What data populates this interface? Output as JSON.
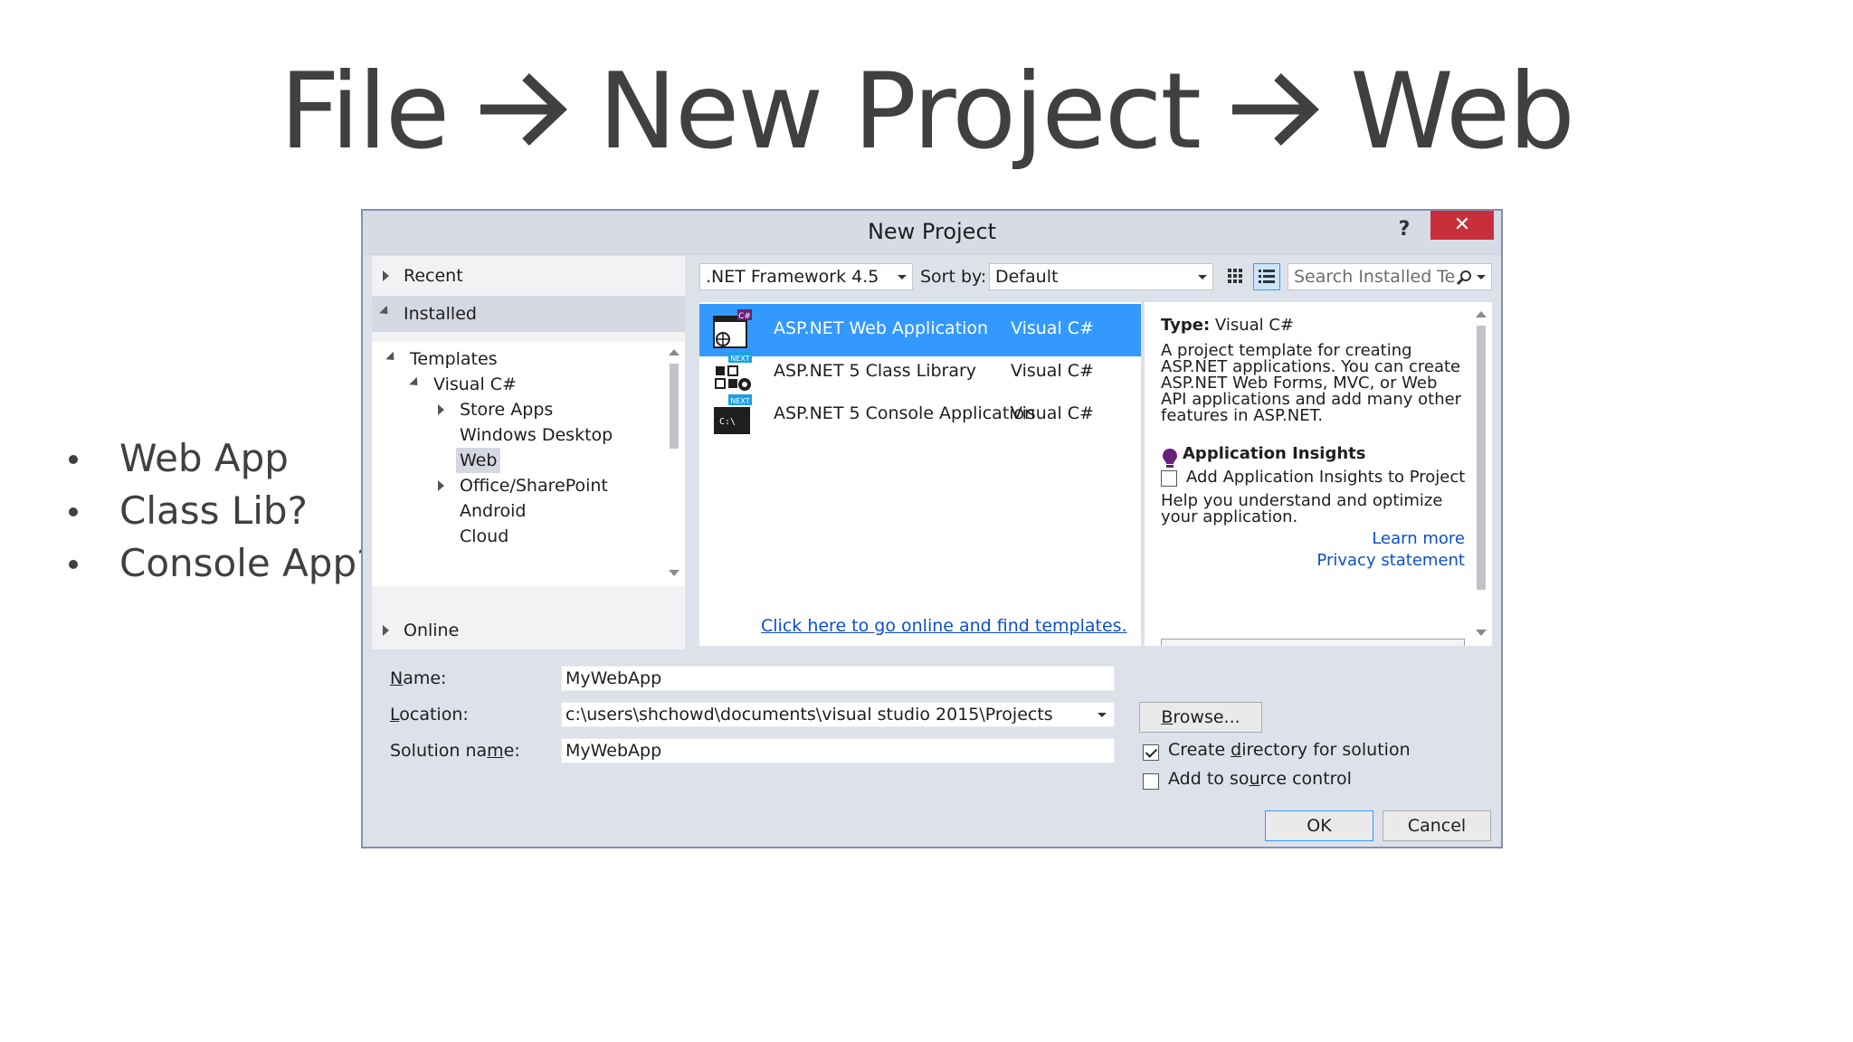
{
  "slide": {
    "title_parts": [
      "File",
      "New Project",
      "Web"
    ],
    "bullets": [
      "Web App",
      "Class Lib?",
      "Console App?"
    ]
  },
  "dialog": {
    "title": "New Project",
    "help": "?",
    "close": "✕",
    "left_panel": {
      "recent": "Recent",
      "installed": "Installed",
      "tree": [
        {
          "label": "Templates"
        },
        {
          "label": "Visual C#"
        },
        {
          "label": "Store Apps"
        },
        {
          "label": "Windows Desktop"
        },
        {
          "label": "Web"
        },
        {
          "label": "Office/SharePoint"
        },
        {
          "label": "Android"
        },
        {
          "label": "Cloud"
        }
      ],
      "online": "Online"
    },
    "toolbar": {
      "framework": ".NET Framework 4.5",
      "sort_label": "Sort by:",
      "sort_value": "Default",
      "search_placeholder": "Search Installed Te"
    },
    "templates": [
      {
        "name": "ASP.NET Web Application",
        "lang": "Visual C#",
        "selected": true,
        "icon": "web-application-icon"
      },
      {
        "name": "ASP.NET 5 Class Library",
        "lang": "Visual C#",
        "selected": false,
        "icon": "class-library-icon"
      },
      {
        "name": "ASP.NET 5 Console Application",
        "lang": "Visual C#",
        "selected": false,
        "icon": "console-application-icon"
      }
    ],
    "online_link": "Click here to go online and find templates.",
    "description": {
      "type_label": "Type:",
      "type_value": "Visual C#",
      "lines": [
        "A project template for creating",
        "ASP.NET applications. You can create",
        "ASP.NET Web Forms, MVC,  or Web",
        "API applications and add many other",
        "features in ASP.NET."
      ],
      "insights_title": "Application Insights",
      "insights_checkbox": "Add Application Insights to Project",
      "help_lines": [
        "Help you understand and optimize",
        "your application."
      ],
      "learn_more": "Learn more",
      "privacy": "Privacy statement"
    },
    "form": {
      "name_label": "Name:",
      "name_value": "MyWebApp",
      "location_label": "Location:",
      "location_value": "c:\\users\\shchowd\\documents\\visual studio 2015\\Projects",
      "solution_label": "Solution name:",
      "solution_value": "MyWebApp",
      "browse": "Browse...",
      "create_dir": "Create directory for solution",
      "create_dir_checked": true,
      "source_control": "Add to source control",
      "source_control_checked": false,
      "ok": "OK",
      "cancel": "Cancel"
    }
  }
}
